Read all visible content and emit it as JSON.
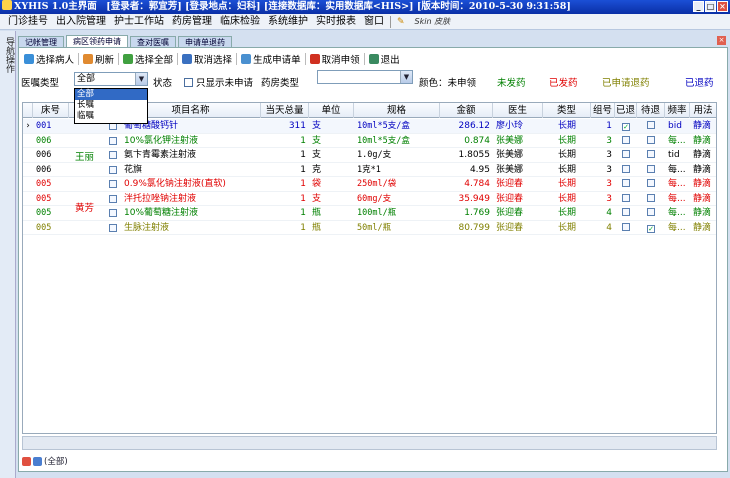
{
  "window": {
    "title": "XYHIS 1.0主界面　[登录者：郭宜芳] [登录地点：妇科] [连接数据库：实用数据库<HIS>] [版本时间：2010-5-30 9:31:58]",
    "controls": [
      "_",
      "□",
      "×"
    ]
  },
  "menu": {
    "items": [
      "门诊挂号",
      "出入院管理",
      "护士工作站",
      "药房管理",
      "临床检验",
      "系统维护",
      "实时报表",
      "窗口"
    ],
    "skin_label": "Skin 皮肤"
  },
  "left_rail": {
    "label": "导航操作"
  },
  "tabs": [
    {
      "label": "记帐管理",
      "active": false
    },
    {
      "label": "病区领药申请",
      "active": true
    },
    {
      "label": "查对医嘱",
      "active": false
    },
    {
      "label": "申请单退药",
      "active": false
    }
  ],
  "toolbar": [
    {
      "label": "选择病人",
      "icon": "select-patient-icon",
      "color": "#3a8fd8"
    },
    {
      "label": "刷新",
      "icon": "refresh-icon",
      "color": "#e08a30"
    },
    {
      "label": "选择全部",
      "icon": "select-all-icon",
      "color": "#40a040"
    },
    {
      "label": "取消选择",
      "icon": "deselect-icon",
      "color": "#3a70c0"
    },
    {
      "label": "生成申请单",
      "icon": "generate-request-icon",
      "color": "#4a90d0"
    },
    {
      "label": "取消申领",
      "icon": "cancel-request-icon",
      "color": "#d03020"
    },
    {
      "label": "退出",
      "icon": "exit-icon",
      "color": "#3a8a60"
    }
  ],
  "filters": {
    "order_type_label": "医嘱类型",
    "order_type_value": "全部",
    "order_type_options": [
      "全部",
      "长嘱",
      "临嘱"
    ],
    "status_label": "状态",
    "only_unrequested_label": "只显示未申请",
    "drug_type_label": "药房类型",
    "drug_type_value": ""
  },
  "legend": {
    "title": "颜色：未申领",
    "items": [
      {
        "label": "未发药",
        "color": "#008000"
      },
      {
        "label": "已发药",
        "color": "#e00000"
      },
      {
        "label": "已申请退药",
        "color": "#808000"
      },
      {
        "label": "已退药",
        "color": "#0000c0"
      }
    ]
  },
  "grid": {
    "columns": [
      "床号",
      "",
      "项目名称",
      "当天总量",
      "单位",
      "规格",
      "金额",
      "医生",
      "类型",
      "组号",
      "已退",
      "待退",
      "频率",
      "用法"
    ],
    "patients": [
      {
        "name": "王丽",
        "color": "#008000"
      },
      {
        "name": "黄芳",
        "color": "#e00000"
      }
    ],
    "rows": [
      {
        "bed": "001",
        "item": "葡萄糖酸钙针",
        "qty": "311",
        "unit": "支",
        "spec": "10ml*5支/盒",
        "amount": "286.12",
        "doctor": "廖小玲",
        "type": "长期",
        "group": "1",
        "returned": true,
        "pending": false,
        "freq": "bid",
        "usage": "静滴",
        "color": "#0000c0",
        "pointer": true
      },
      {
        "bed": "006",
        "item": "10%氯化钾注射液",
        "qty": "1",
        "unit": "支",
        "spec": "10ml*5支/盒",
        "amount": "0.874",
        "doctor": "张美娜",
        "type": "长期",
        "group": "3",
        "returned": false,
        "pending": false,
        "freq": "每...",
        "usage": "静滴",
        "color": "#008000",
        "pointer": false
      },
      {
        "bed": "006",
        "item": "氨卞青霉素注射液",
        "qty": "1",
        "unit": "支",
        "spec": "1.0g/支",
        "amount": "1.8055",
        "doctor": "张美娜",
        "type": "长期",
        "group": "3",
        "returned": false,
        "pending": false,
        "freq": "tid",
        "usage": "静滴",
        "color": "#000000",
        "pointer": false
      },
      {
        "bed": "006",
        "item": "花旗",
        "qty": "1",
        "unit": "克",
        "spec": "1克*1",
        "amount": "4.95",
        "doctor": "张美娜",
        "type": "长期",
        "group": "3",
        "returned": false,
        "pending": false,
        "freq": "每...",
        "usage": "静滴",
        "color": "#000000",
        "pointer": false
      },
      {
        "bed": "005",
        "item": "0.9%氯化钠注射液(直软)",
        "qty": "1",
        "unit": "袋",
        "spec": "250ml/袋",
        "amount": "4.784",
        "doctor": "张迎春",
        "type": "长期",
        "group": "3",
        "returned": false,
        "pending": false,
        "freq": "每...",
        "usage": "静滴",
        "color": "#e00000",
        "pointer": false
      },
      {
        "bed": "005",
        "item": "泮托拉唑钠注射液",
        "qty": "1",
        "unit": "支",
        "spec": "60mg/支",
        "amount": "35.949",
        "doctor": "张迎春",
        "type": "长期",
        "group": "3",
        "returned": false,
        "pending": false,
        "freq": "每...",
        "usage": "静滴",
        "color": "#e00000",
        "pointer": false
      },
      {
        "bed": "005",
        "item": "10%葡萄糖注射液",
        "qty": "1",
        "unit": "瓶",
        "spec": "100ml/瓶",
        "amount": "1.769",
        "doctor": "张迎春",
        "type": "长期",
        "group": "4",
        "returned": false,
        "pending": false,
        "freq": "每...",
        "usage": "静滴",
        "color": "#008000",
        "pointer": false
      },
      {
        "bed": "005",
        "item": "生脉注射液",
        "qty": "1",
        "unit": "瓶",
        "spec": "50ml/瓶",
        "amount": "80.799",
        "doctor": "张迎春",
        "type": "长期",
        "group": "4",
        "returned": false,
        "pending": true,
        "freq": "每...",
        "usage": "静滴",
        "color": "#808000",
        "pointer": false
      }
    ]
  },
  "footer": {
    "filter_text": "(全部)"
  }
}
